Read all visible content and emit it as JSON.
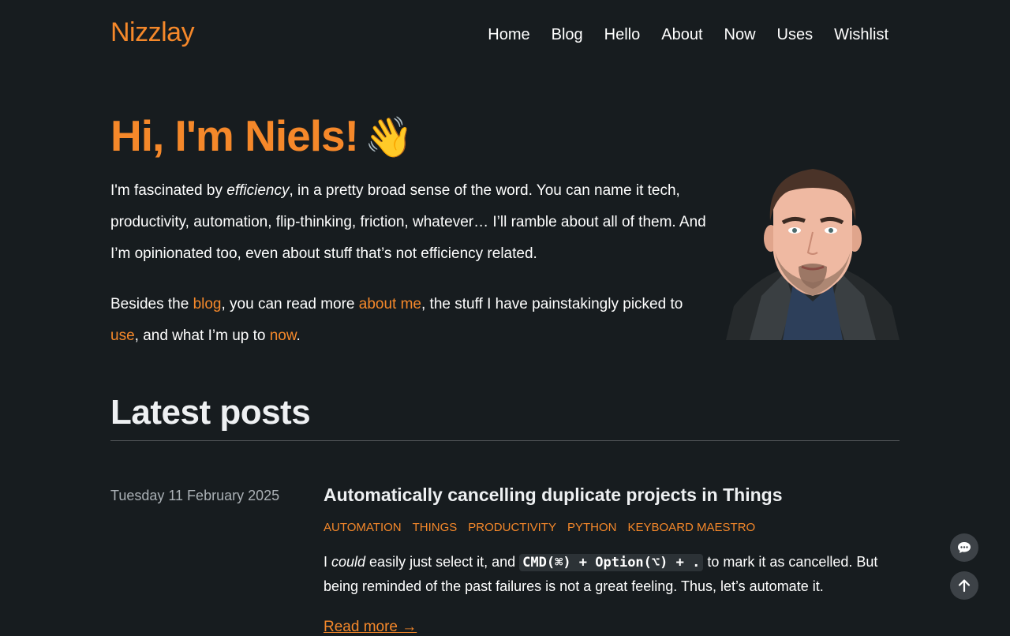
{
  "header": {
    "site_title": "Nizzlay",
    "nav": [
      "Home",
      "Blog",
      "Hello",
      "About",
      "Now",
      "Uses",
      "Wishlist"
    ]
  },
  "hero": {
    "title": "Hi, I'm Niels!",
    "emoji": "👋",
    "p1_a": "I'm fascinated by ",
    "p1_em": "efficiency",
    "p1_b": ", in a pretty broad sense of the word. You can name it tech, productivity, automation, flip-thinking, friction, whatever… I’ll ramble about all of them. And I’m opinionated too, even about stuff that’s not efficiency related.",
    "p2_a": "Besides the ",
    "p2_link_blog": "blog",
    "p2_b": ", you can read more ",
    "p2_link_about": "about me",
    "p2_c": ", the stuff I have painstakingly picked to ",
    "p2_link_use": "use",
    "p2_d": ", and what I’m up to ",
    "p2_link_now": "now",
    "p2_e": "."
  },
  "latest": {
    "heading": "Latest posts",
    "posts": [
      {
        "date": "Tuesday 11 February 2025",
        "title": "Automatically cancelling duplicate projects in Things",
        "tags": [
          "AUTOMATION",
          "THINGS",
          "PRODUCTIVITY",
          "PYTHON",
          "KEYBOARD MAESTRO"
        ],
        "excerpt_a": "I ",
        "excerpt_em": "could",
        "excerpt_b": " easily just select it, and ",
        "excerpt_code": "CMD(⌘) + Option(⌥) + .",
        "excerpt_c": " to mark it as cancelled. But being reminded of the past failures is not a great feeling. Thus, let’s automate it.",
        "read_more": "Read more →"
      }
    ]
  },
  "floating": {
    "icons": [
      "chat-bubble-icon",
      "arrow-up-icon"
    ]
  },
  "colors": {
    "background": "#171c1f",
    "accent": "#f5882a",
    "text": "#ffffff",
    "muted": "#aab0b5"
  }
}
